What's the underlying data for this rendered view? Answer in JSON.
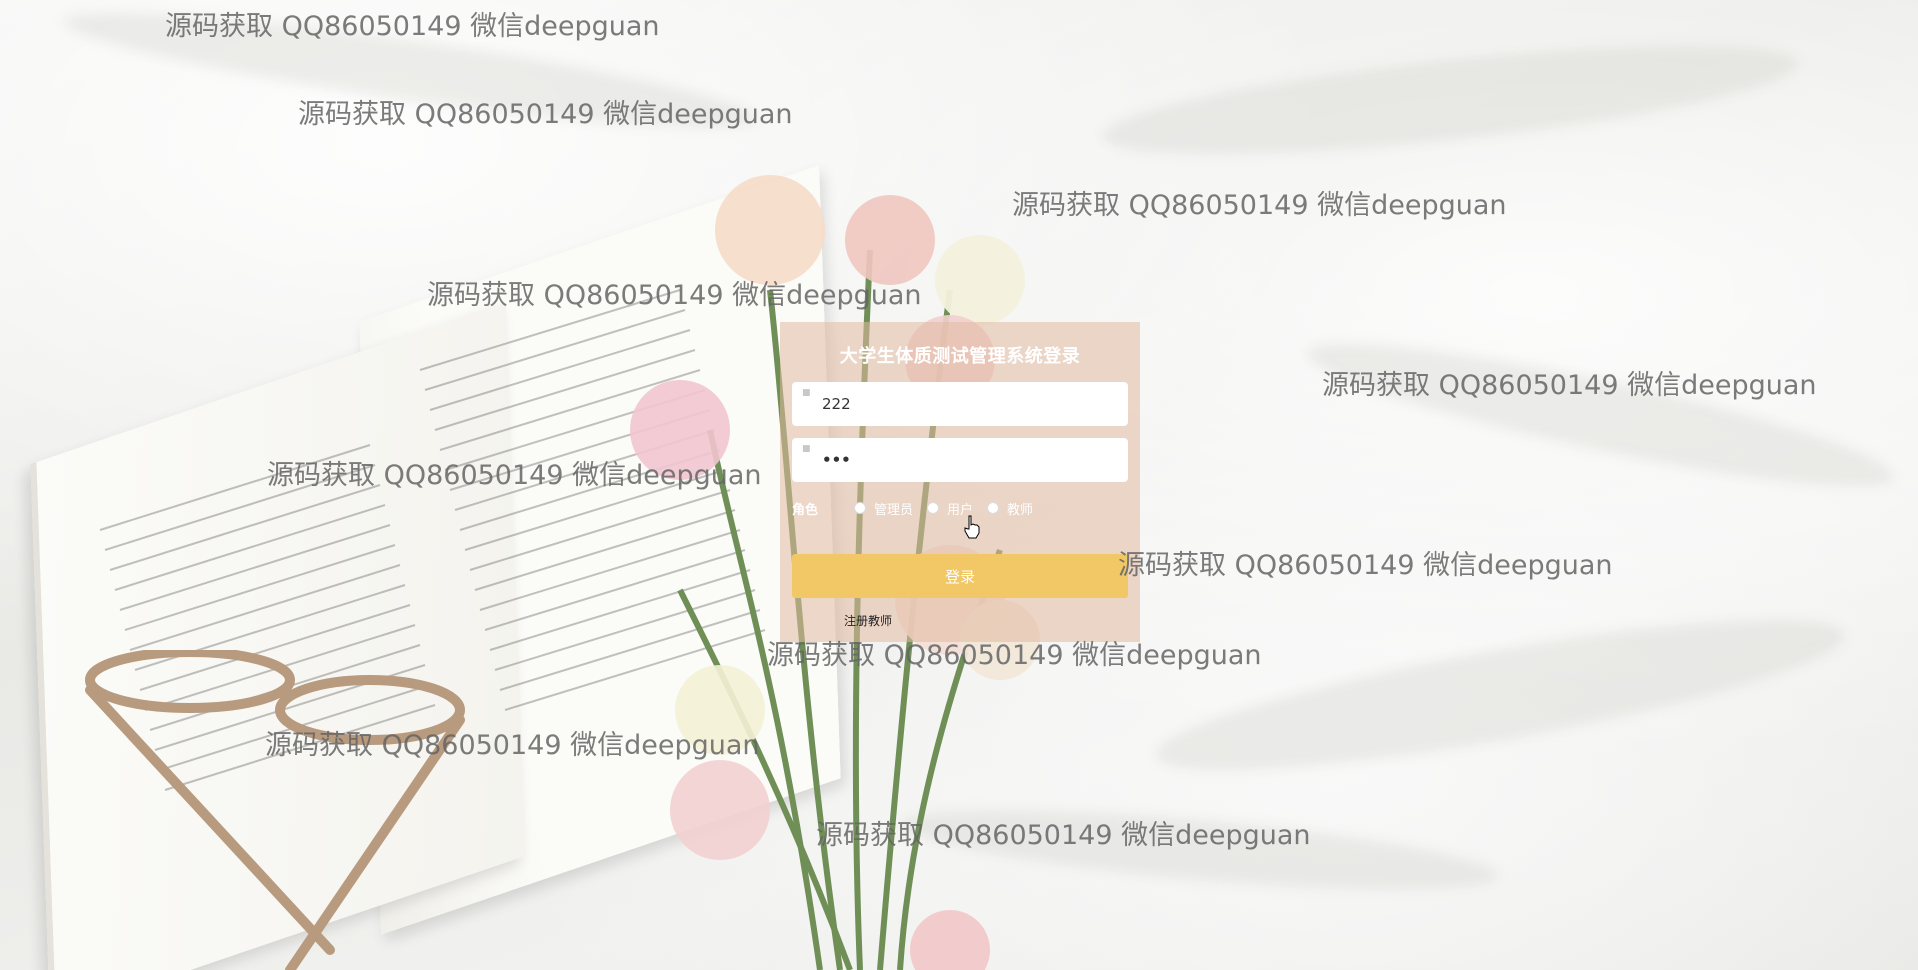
{
  "login": {
    "title": "大学生体质测试管理系统登录",
    "username_value": "222",
    "password_value": "•••",
    "role_label": "角色",
    "roles": [
      {
        "label": "管理员",
        "selected": false
      },
      {
        "label": "用户",
        "selected": false
      },
      {
        "label": "教师",
        "selected": false
      }
    ],
    "submit_label": "登录",
    "register_link": "注册教师"
  },
  "watermarks": [
    "源码获取 QQ86050149 微信deepguan",
    "源码获取 QQ86050149 微信deepguan",
    "源码获取 QQ86050149 微信deepguan",
    "源码获取 QQ86050149 微信deepguan",
    "源码获取 QQ86050149 微信deepguan",
    "源码获取 QQ86050149 微信deepguan",
    "源码获取 QQ86050149 微信deepguan",
    "源码获取 QQ86050149 微信deepguan",
    "源码获取 QQ86050149 微信deepguan",
    "源码获取 QQ86050149 微信deepguan"
  ],
  "colors": {
    "panel": "#e1b9a0",
    "button": "#f2c866",
    "background": "#ececea"
  },
  "icons": [
    "user-icon",
    "lock-icon",
    "hand-cursor-icon"
  ]
}
